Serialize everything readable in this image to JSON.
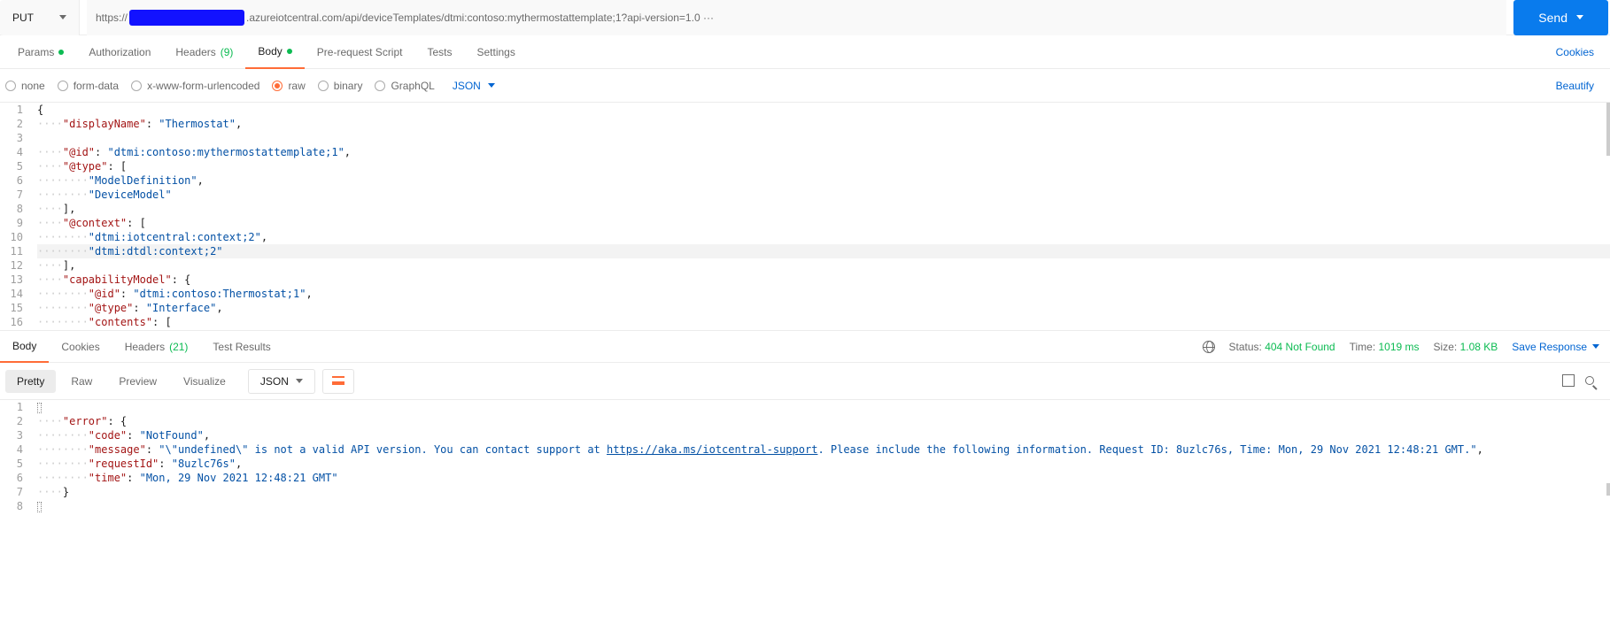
{
  "request": {
    "method": "PUT",
    "url_prefix": "https://",
    "url_suffix": ".azureiotcentral.com/api/deviceTemplates/dtmi:contoso:mythermostattemplate;1?api-version=1.0 ···",
    "send": "Send"
  },
  "req_tabs": {
    "params": "Params",
    "authorization": "Authorization",
    "headers": "Headers",
    "headers_count": "(9)",
    "body": "Body",
    "prerequest": "Pre-request Script",
    "tests": "Tests",
    "settings": "Settings",
    "cookies": "Cookies"
  },
  "body_types": {
    "none": "none",
    "formdata": "form-data",
    "urlencoded": "x-www-form-urlencoded",
    "raw": "raw",
    "binary": "binary",
    "graphql": "GraphQL",
    "format": "JSON",
    "beautify": "Beautify"
  },
  "req_body": {
    "l1": "{",
    "l2_k": "\"displayName\"",
    "l2_v": "\"Thermostat\"",
    "l4_k": "\"@id\"",
    "l4_v": "\"dtmi:contoso:mythermostattemplate;1\"",
    "l5_k": "\"@type\"",
    "l6_v": "\"ModelDefinition\"",
    "l7_v": "\"DeviceModel\"",
    "l9_k": "\"@context\"",
    "l10_v": "\"dtmi:iotcentral:context;2\"",
    "l11_v": "\"dtmi:dtdl:context;2\"",
    "l13_k": "\"capabilityModel\"",
    "l14_k": "\"@id\"",
    "l14_v": "\"dtmi:contoso:Thermostat;1\"",
    "l15_k": "\"@type\"",
    "l15_v": "\"Interface\"",
    "l16_k": "\"contents\""
  },
  "resp_tabs": {
    "body": "Body",
    "cookies": "Cookies",
    "headers": "Headers",
    "headers_count": "(21)",
    "tests": "Test Results"
  },
  "status": {
    "status_label": "Status:",
    "status_value": "404 Not Found",
    "time_label": "Time:",
    "time_value": "1019 ms",
    "size_label": "Size:",
    "size_value": "1.08 KB",
    "save": "Save Response"
  },
  "views": {
    "pretty": "Pretty",
    "raw": "Raw",
    "preview": "Preview",
    "visualize": "Visualize",
    "json": "JSON"
  },
  "resp_body": {
    "l2_k": "\"error\"",
    "l3_k": "\"code\"",
    "l3_v": "\"NotFound\"",
    "l4_k": "\"message\"",
    "l4_v1": "\"\\\"undefined\\\" is not a valid API version. You can contact support at ",
    "l4_link": "https://aka.ms/iotcentral-support",
    "l4_v2": ". Please include the following information. Request ID: 8uzlc76s, Time: Mon, 29 Nov 2021 12:48:21 GMT.\"",
    "l5_k": "\"requestId\"",
    "l5_v": "\"8uzlc76s\"",
    "l6_k": "\"time\"",
    "l6_v": "\"Mon, 29 Nov 2021 12:48:21 GMT\""
  }
}
